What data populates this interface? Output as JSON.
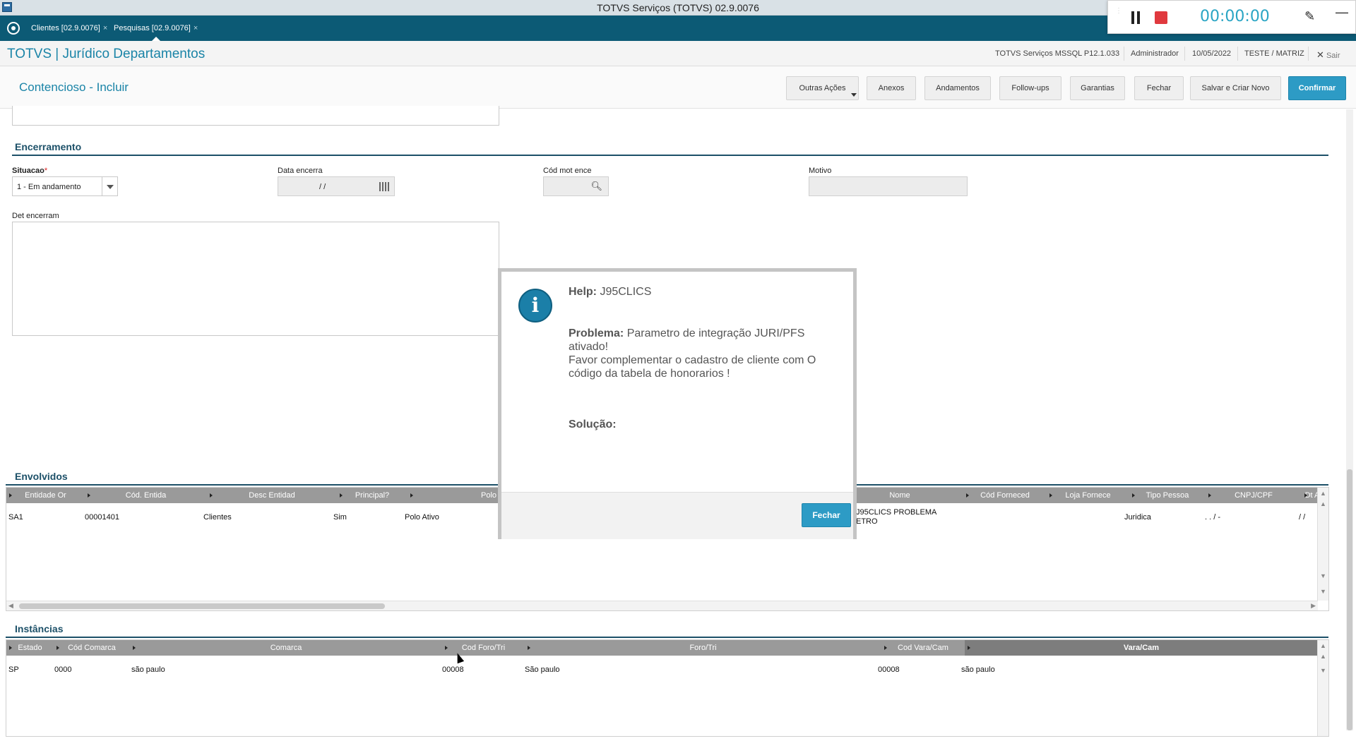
{
  "window": {
    "title": "TOTVS Serviços (TOTVS) 02.9.0076"
  },
  "tabs": [
    {
      "label": "Clientes [02.9.0076]",
      "close": "×"
    },
    {
      "label": "Pesquisas [02.9.0076]",
      "close": "×"
    }
  ],
  "recorder": {
    "time": "00:00:00"
  },
  "header": {
    "brand": "TOTVS | Jurídico Departamentos",
    "server": "TOTVS Serviços MSSQL P12.1.033",
    "user": "Administrador",
    "date": "10/05/2022",
    "company": "TESTE / MATRIZ",
    "exit_icon": "close-icon",
    "exit_label": "Sair"
  },
  "page": {
    "title": "Contencioso - Incluir",
    "buttons": {
      "outras_acoes": "Outras Ações",
      "anexos": "Anexos",
      "andamentos": "Andamentos",
      "followups": "Follow-ups",
      "garantias": "Garantias",
      "fechar": "Fechar",
      "salvar_criar": "Salvar e Criar Novo",
      "confirmar": "Confirmar"
    }
  },
  "encerramento": {
    "title": "Encerramento",
    "situacao_label": "Situacao",
    "situacao_required": "*",
    "situacao_value": "1 - Em andamento",
    "data_label": "Data encerra",
    "data_value": "/ /",
    "codmot_label": "Cód mot ence",
    "motivo_label": "Motivo",
    "detalhe_label": "Det encerram"
  },
  "envolvidos": {
    "title": "Envolvidos",
    "columns": [
      "Entidade Or",
      "Cód. Entida",
      "Desc Entidad",
      "Principal?",
      "Polo",
      "Nome",
      "Cód Forneced",
      "Loja Fornece",
      "Tipo Pessoa",
      "CNPJ/CPF",
      "Dt A"
    ],
    "row": {
      "entidade": "SA1",
      "cod": "00001401",
      "desc": "Clientes",
      "principal": "Sim",
      "polo": "Polo Ativo",
      "nome1": "J95CLICS PROBLEMA",
      "nome2": "ETRO",
      "tipo": "Juridica",
      "cnpj": ". . / -",
      "dt": "/ /"
    }
  },
  "instancias": {
    "title": "Instâncias",
    "columns": [
      "Estado",
      "Cód Comarca",
      "Comarca",
      "Cod Foro/Tri",
      "Foro/Tri",
      "Cod Vara/Cam",
      "Vara/Cam"
    ],
    "row": {
      "estado": "SP",
      "cod_comarca": "0000",
      "comarca": "são paulo",
      "cod_foro": "00008",
      "foro": "São paulo",
      "cod_vara": "00008",
      "vara": "são paulo"
    }
  },
  "modal": {
    "help_label": "Help:",
    "help_value": "J95CLICS",
    "problema_label": "Problema:",
    "problema_line1": "Parametro de integração JURI/PFS",
    "problema_line2": "ativado!",
    "problema_line3": "Favor complementar o cadastro de cliente com O",
    "problema_line4": "código da tabela de honorarios !",
    "solucao_label": "Solução:",
    "button": "Fechar"
  }
}
